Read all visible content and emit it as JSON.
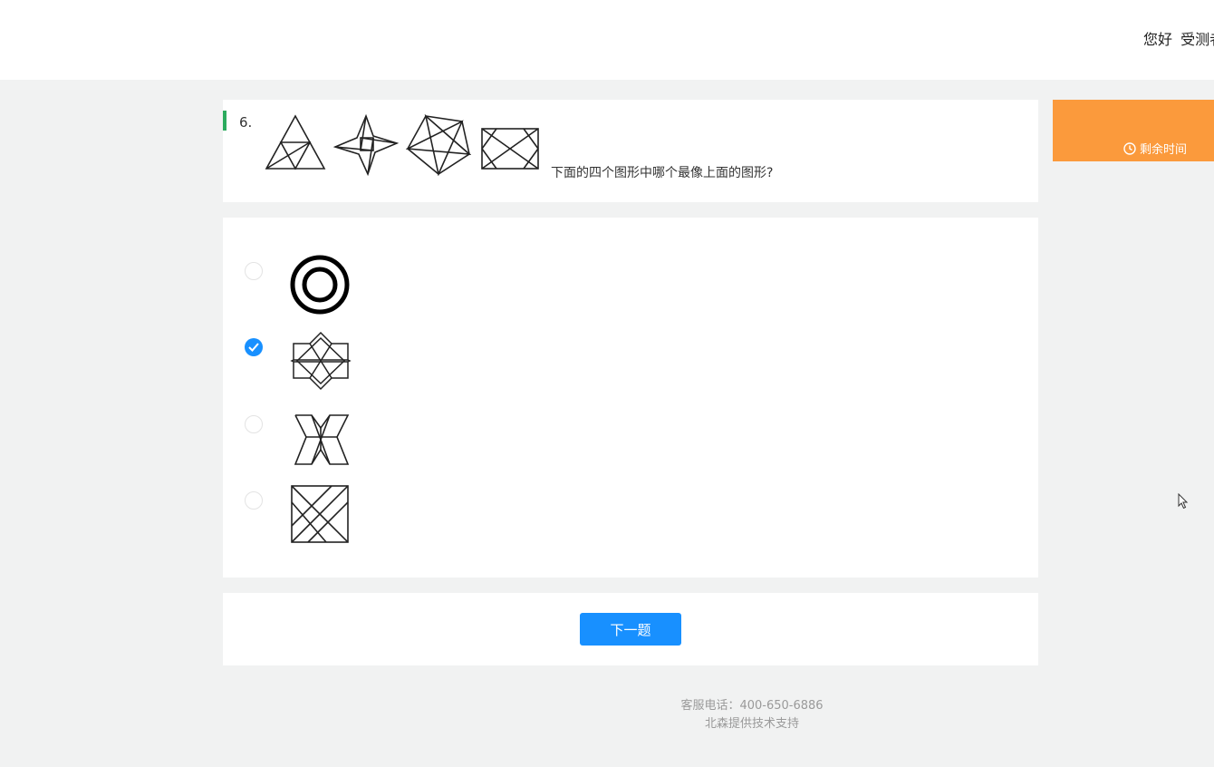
{
  "header": {
    "greeting": "您好",
    "user_name": "受测者"
  },
  "question": {
    "number": "6.",
    "text": "下面的四个图形中哪个最像上面的图形?",
    "reference_shapes": [
      "triangle-figure",
      "four-point-star-figure",
      "pentagon-star-figure",
      "rectangle-cross-figure"
    ]
  },
  "options": [
    {
      "shape": "concentric-circles",
      "selected": false
    },
    {
      "shape": "octagram-lattice",
      "selected": true
    },
    {
      "shape": "hourglass-cross",
      "selected": false
    },
    {
      "shape": "square-diagonals",
      "selected": false
    }
  ],
  "navigation": {
    "next_label": "下一题"
  },
  "timer": {
    "label": "剩余时间",
    "color": "#fb9a3c"
  },
  "footer": {
    "phone": "客服电话：400-650-6886",
    "support": "北森提供技术支持"
  },
  "colors": {
    "accent": "#1890ff",
    "marker": "#2bab5e"
  }
}
